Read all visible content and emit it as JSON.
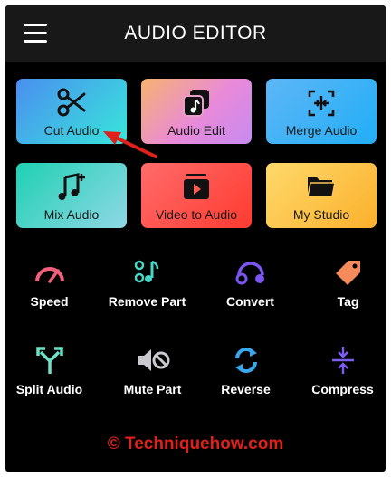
{
  "header": {
    "title": "AUDIO EDITOR"
  },
  "cards": [
    {
      "label": "Cut Audio",
      "icon": "scissors-icon"
    },
    {
      "label": "Audio Edit",
      "icon": "audio-edit-icon"
    },
    {
      "label": "Merge Audio",
      "icon": "merge-icon"
    },
    {
      "label": "Mix Audio",
      "icon": "music-add-icon"
    },
    {
      "label": "Video to Audio",
      "icon": "video-icon"
    },
    {
      "label": "My Studio",
      "icon": "folder-icon"
    }
  ],
  "tools": [
    {
      "label": "Speed",
      "icon": "speed-gauge-icon"
    },
    {
      "label": "Remove Part",
      "icon": "remove-part-icon"
    },
    {
      "label": "Convert",
      "icon": "convert-icon"
    },
    {
      "label": "Tag",
      "icon": "tag-icon"
    },
    {
      "label": "Split Audio",
      "icon": "split-icon"
    },
    {
      "label": "Mute Part",
      "icon": "mute-icon"
    },
    {
      "label": "Reverse",
      "icon": "reverse-icon"
    },
    {
      "label": "Compress",
      "icon": "compress-icon"
    }
  ],
  "watermark": "© Techniquehow.com",
  "colors": {
    "background": "#000000",
    "topbar": "#181818",
    "watermark": "#e0201b",
    "annotation_arrow": "#e0201b"
  }
}
